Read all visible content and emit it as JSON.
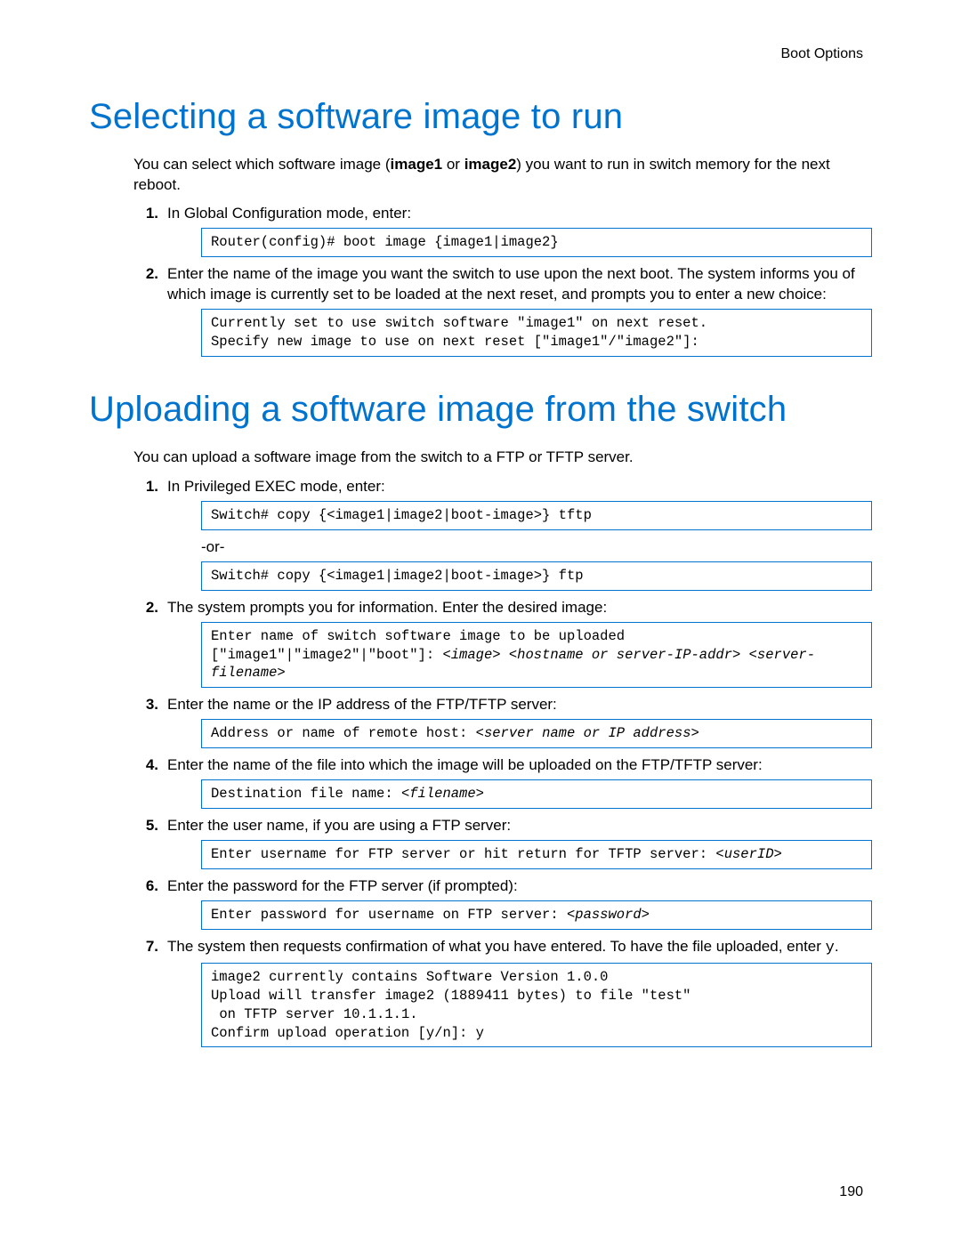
{
  "running_head": "Boot Options",
  "page_number": "190",
  "section1": {
    "title": "Selecting a software image to run",
    "intro_pre": "You can select which software image (",
    "intro_b1": "image1",
    "intro_mid": " or ",
    "intro_b2": "image2",
    "intro_post": ") you want to run in switch memory for the next reboot.",
    "steps": [
      {
        "num": "1.",
        "text": "In Global Configuration mode, enter:",
        "code": "Router(config)# boot image {image1|image2}"
      },
      {
        "num": "2.",
        "text": "Enter the name of the image you want the switch to use upon the next boot. The system informs you of which image is currently set to be loaded at the next reset, and prompts you to enter a new choice:",
        "code": "Currently set to use switch software \"image1\" on next reset.\nSpecify new image to use on next reset [\"image1\"/\"image2\"]:"
      }
    ]
  },
  "section2": {
    "title": "Uploading a software image from the switch",
    "intro": "You can upload a software image from the switch to a FTP or TFTP server.",
    "or_label": "-or-",
    "steps": {
      "s1": {
        "num": "1.",
        "text": "In Privileged EXEC mode, enter:",
        "code_a": "Switch# copy {<image1|image2|boot-image>} tftp",
        "code_b": "Switch# copy {<image1|image2|boot-image>} ftp"
      },
      "s2": {
        "num": "2.",
        "text": "The system prompts you for information. Enter the desired image:",
        "code_plain": "Enter name of switch software image to be uploaded\n[\"image1\"|\"image2\"|\"boot\"]: ",
        "code_italic": "<image> <hostname or server-IP-addr> <server-filename>"
      },
      "s3": {
        "num": "3.",
        "text": "Enter the name or the IP address of the FTP/TFTP server:",
        "code_plain": "Address or name of remote host: ",
        "code_italic": "<server name or IP address>"
      },
      "s4": {
        "num": "4.",
        "text": "Enter the name of the file into which the image will be uploaded on the FTP/TFTP server:",
        "code_plain": "Destination file name: ",
        "code_italic": "<filename>"
      },
      "s5": {
        "num": "5.",
        "text": "Enter the user name, if you are using a FTP server:",
        "code_plain": "Enter username for FTP server or hit return for TFTP server: ",
        "code_italic": "<userID>"
      },
      "s6": {
        "num": "6.",
        "text": "Enter the password for the FTP server (if prompted):",
        "code_plain": "Enter password for username on FTP server: ",
        "code_italic": "<password>"
      },
      "s7": {
        "num": "7.",
        "text_pre": "The system then requests confirmation of what you have entered. To have the file uploaded, enter ",
        "text_mono": "y",
        "text_post": ".",
        "code": "image2 currently contains Software Version 1.0.0\nUpload will transfer image2 (1889411 bytes) to file \"test\"\n on TFTP server 10.1.1.1.\nConfirm upload operation [y/n]: y"
      }
    }
  }
}
